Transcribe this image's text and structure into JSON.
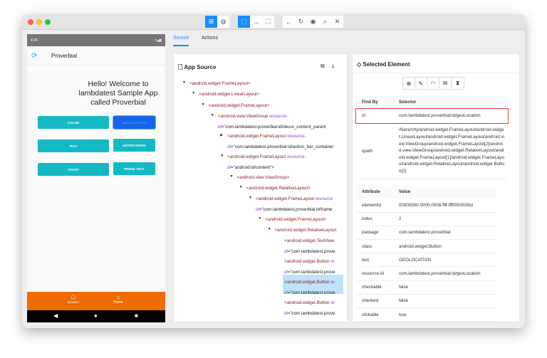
{
  "toolbar": {
    "buttons": [
      {
        "icon": "grid-icon",
        "active": true
      },
      {
        "icon": "globe-icon",
        "active": false
      },
      {
        "icon": "select-pointer-icon",
        "active": true
      },
      {
        "icon": "arrow-right-icon",
        "active": false
      },
      {
        "icon": "fullscreen-icon",
        "active": false
      },
      {
        "icon": "back-arrow-icon",
        "active": false
      },
      {
        "icon": "refresh-icon",
        "active": false
      },
      {
        "icon": "eye-icon",
        "active": false
      },
      {
        "icon": "search-icon",
        "active": false
      },
      {
        "icon": "close-icon",
        "active": false
      }
    ]
  },
  "phone": {
    "time": "4:26",
    "app_title": "Proverbial",
    "welcome": "Hello! Welcome to lambdatest Sample App called Proverbial",
    "buttons": [
      "COLOR",
      "GEOLOCATION",
      "TEXT",
      "NOTIFICATION",
      "TOAST",
      "SPEED TEST"
    ],
    "bottom_nav": [
      "Browser",
      "Home"
    ],
    "accent": "#14b9c4",
    "nav_color": "#ef6c00"
  },
  "tabs": [
    "Source",
    "Actions"
  ],
  "source": {
    "title": "App Source",
    "rows": [
      {
        "tag": "<android.widget.FrameLayout>"
      },
      {
        "tag": "<android.widget.LinearLayout>"
      },
      {
        "tag": "<android.widget.FrameLayout>"
      },
      {
        "tag": "<android.view.ViewGroup ",
        "attr": "resource-",
        "attr2": "id",
        "val": "=\"com.lambdatest.proverbial:id/decor_content_parent"
      },
      {
        "tag": "<android.widget.FrameLayout ",
        "attr": "resource-",
        "attr2": "id",
        "val": "=\"com.lambdatest.proverbial:id/action_bar_container"
      },
      {
        "tag": "<android.widget.FrameLayout ",
        "attr": "resource-",
        "attr2": "id",
        "val": "=\"android:id/content\">"
      },
      {
        "tag": "<android.view.ViewGroup>"
      },
      {
        "tag": "<android.widget.RelativeLayout>"
      },
      {
        "tag": "<android.widget.FrameLayout ",
        "attr": "resource",
        "attr2": "id",
        "val": "=\"com.lambdatest.proverbial:id/frame"
      },
      {
        "tag": "<android.widget.FrameLayout>"
      },
      {
        "tag": "<android.widget.RelativeLayout"
      },
      {
        "tag": "<android.widget.TextView",
        "attr2": "id",
        "val": "=\"com.lambdatest.prove"
      },
      {
        "tag": "<android.widget.Button ",
        "attr": "re",
        "attr2": "id",
        "val": "=\"com.lambdatest.prove"
      },
      {
        "tag": "<android.widget.Button ",
        "attr": "re",
        "attr2": "id",
        "val": "=\"com.lambdatest.prove"
      },
      {
        "tag": "<android.widget.Button ",
        "attr": "re",
        "attr2": "id",
        "val": "=\"com.lambdatest.prove"
      }
    ]
  },
  "selected": {
    "title": "Selected Element",
    "actions": [
      "tap-icon",
      "edit-icon",
      "clear-icon",
      "copy-icon",
      "timer-icon"
    ],
    "find_headers": [
      "Find By",
      "Selector"
    ],
    "find": [
      {
        "by": "id",
        "sel": "com.lambdatest.proverbial:id/geoLocation"
      },
      {
        "by": "xpath",
        "sel": "/hierarchy/android.widget.FrameLayout/android.widget.LinearLayout/android.widget.FrameLayout/android.view.ViewGroup/android.widget.FrameLayout[2]/android.view.ViewGroup/android.widget.RelativeLayout/android.widget.FrameLayout[1]/android.widget.FrameLayout/android.widget.RelativeLayout/android.widget.Button[2]"
      }
    ],
    "attr_headers": [
      "Attribute",
      "Value"
    ],
    "attrs": [
      [
        "elementId",
        "00000000-0000-0008-ffff-ffff0000000d"
      ],
      [
        "index",
        "2"
      ],
      [
        "package",
        "com.lambdatest.proverbial"
      ],
      [
        "class",
        "android.widget.Button"
      ],
      [
        "text",
        "GEOLOCATION"
      ],
      [
        "resource-id",
        "com.lambdatest.proverbial:id/geoLocation"
      ],
      [
        "checkable",
        "false"
      ],
      [
        "checked",
        "false"
      ],
      [
        "clickable",
        "true"
      ]
    ]
  }
}
